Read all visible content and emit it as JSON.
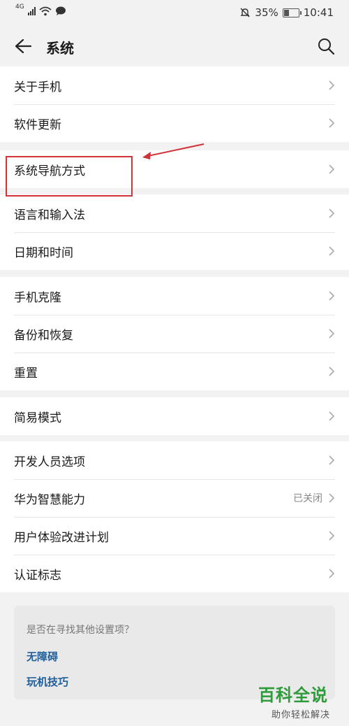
{
  "status_bar": {
    "network": "4G",
    "battery_percent": "35%",
    "time": "10:41"
  },
  "header": {
    "title": "系统"
  },
  "groups": [
    {
      "items": [
        {
          "label": "关于手机"
        },
        {
          "label": "软件更新"
        }
      ]
    },
    {
      "items": [
        {
          "label": "系统导航方式"
        }
      ]
    },
    {
      "items": [
        {
          "label": "语言和输入法"
        },
        {
          "label": "日期和时间"
        }
      ]
    },
    {
      "items": [
        {
          "label": "手机克隆"
        },
        {
          "label": "备份和恢复"
        },
        {
          "label": "重置"
        }
      ]
    },
    {
      "items": [
        {
          "label": "简易模式"
        }
      ]
    },
    {
      "items": [
        {
          "label": "开发人员选项"
        },
        {
          "label": "华为智慧能力",
          "value": "已关闭"
        },
        {
          "label": "用户体验改进计划"
        },
        {
          "label": "认证标志"
        }
      ]
    }
  ],
  "suggestions": {
    "title": "是否在寻找其他设置项？",
    "links": [
      "无障碍",
      "玩机技巧"
    ]
  },
  "watermark": {
    "main": "百科全说",
    "sub": "助你轻松解决"
  },
  "colors": {
    "highlight": "#d0343a",
    "link": "#1f5f9c",
    "watermark": "#2e9b3a"
  }
}
